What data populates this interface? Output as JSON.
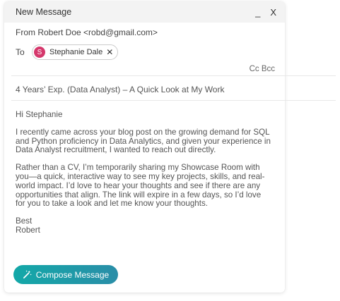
{
  "window": {
    "title": "New Message",
    "minimize": "_",
    "close": "X"
  },
  "from_line": "From Robert Doe <robd@gmail.com>",
  "to": {
    "label": "To",
    "recipient": {
      "initial": "S",
      "name": "Stephanie Dale",
      "avatar_color": "#d5386c"
    }
  },
  "cc": "Cc",
  "bcc": "Bcc",
  "subject": "4 Years’ Exp. (Data Analyst) – A Quick Look at My Work",
  "body": {
    "greeting": "Hi Stephanie",
    "paragraph1": "I recently came across your blog post on the growing demand for SQL and Python proficiency in Data Analytics, and given your experience in Data Analyst recruitment, I wanted to reach out directly.",
    "paragraph2": "Rather than a CV, I’m temporarily sharing my Showcase Room with you—a quick, interactive way to see my key projects, skills, and real-world impact. I’d love to hear your thoughts and see if there are any opportunities that align. The link will expire in a few days, so I’d love for you to take a look and let me know your thoughts.",
    "signoff": "Best",
    "signature": "Robert"
  },
  "compose_button": {
    "label": "Compose Message",
    "icon": "magic-wand-icon",
    "color_start": "#13a8a8",
    "color_end": "#2a8ea8"
  }
}
